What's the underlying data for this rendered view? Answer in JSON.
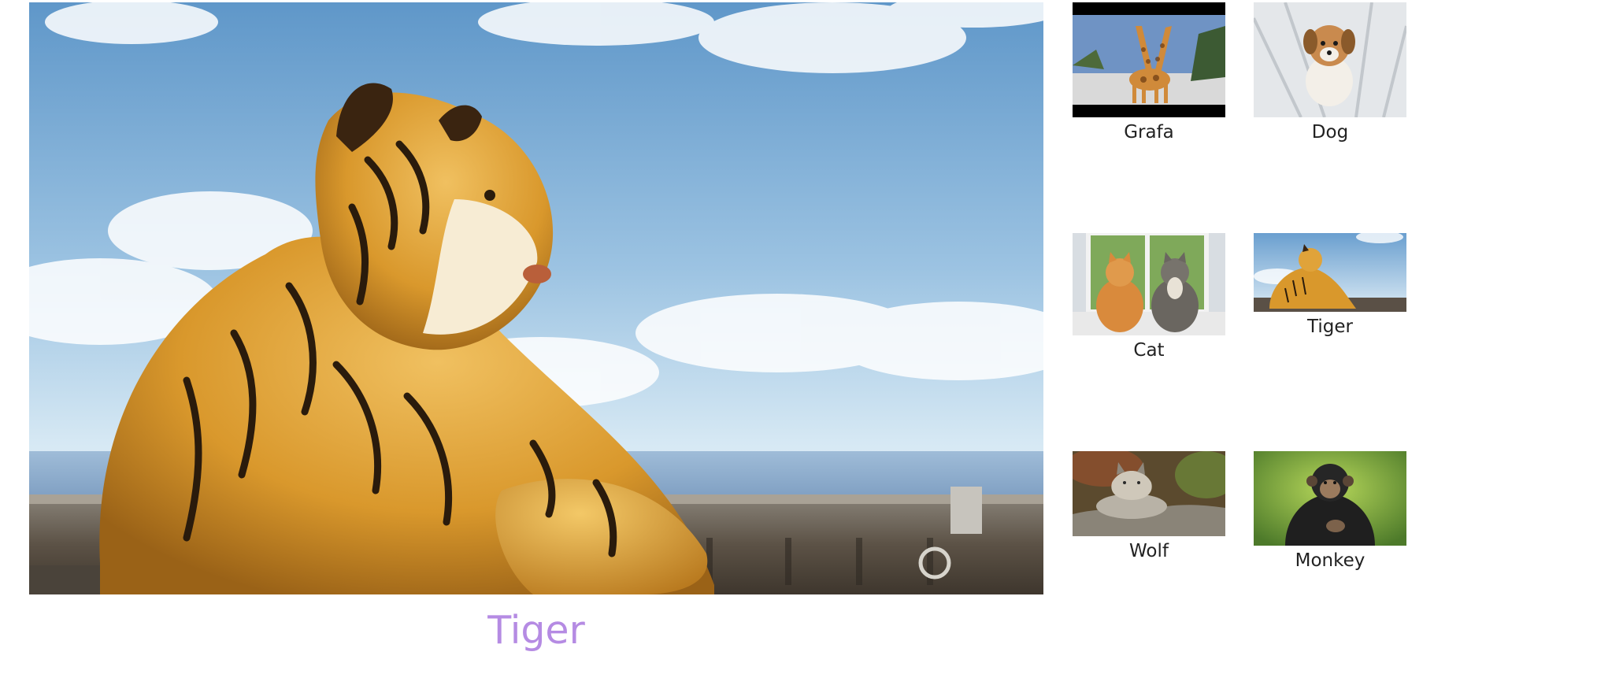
{
  "viewer": {
    "selected_title": "Tiger",
    "caption_color": "#b58be3"
  },
  "gallery": {
    "items": [
      {
        "label": "Grafa"
      },
      {
        "label": "Dog"
      },
      {
        "label": "Cat"
      },
      {
        "label": "Tiger"
      },
      {
        "label": "Wolf"
      },
      {
        "label": "Monkey"
      }
    ]
  }
}
